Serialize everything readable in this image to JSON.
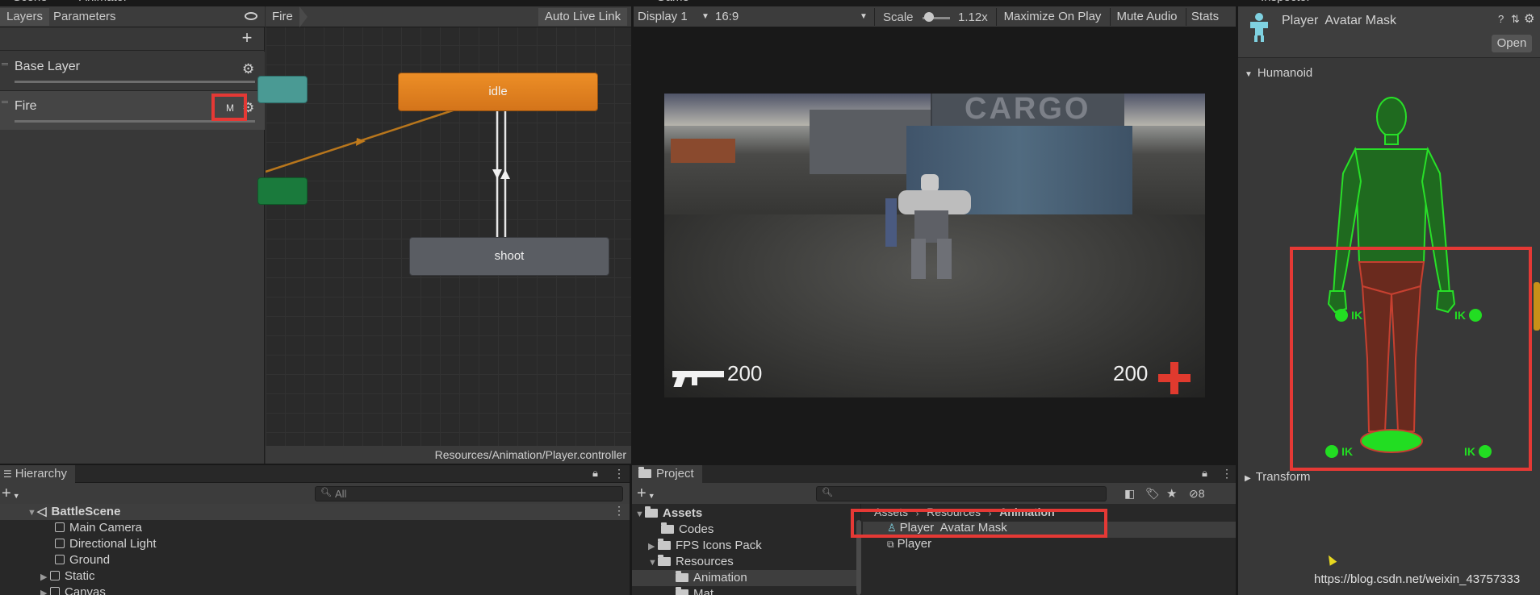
{
  "top_tabs": {
    "scene": "Scene",
    "animator": "Animator",
    "game": "Game",
    "inspector": "Inspector"
  },
  "animator": {
    "tabs": [
      "Layers",
      "Parameters"
    ],
    "breadcrumb": "Fire",
    "auto_live_link": "Auto Live Link",
    "layers": [
      {
        "name": "Base Layer"
      },
      {
        "name": "Fire",
        "badge": "M"
      }
    ],
    "states": {
      "idle": "idle",
      "shoot": "shoot"
    },
    "footer_path": "Resources/Animation/Player.controller"
  },
  "game": {
    "display": "Display 1",
    "aspect": "16:9",
    "scale_label": "Scale",
    "scale_value": "1.12x",
    "maximize": "Maximize On Play",
    "mute": "Mute Audio",
    "stats": "Stats",
    "ammo": "200",
    "health": "200",
    "scene_text": "CARGO"
  },
  "inspector": {
    "asset_title": "Player  Avatar Mask",
    "open_button": "Open",
    "humanoid": "Humanoid",
    "transform": "Transform",
    "ik_label": "IK"
  },
  "hierarchy": {
    "title": "Hierarchy",
    "search_placeholder": "All",
    "items": [
      {
        "label": "BattleScene"
      },
      {
        "label": "Main Camera"
      },
      {
        "label": "Directional Light"
      },
      {
        "label": "Ground"
      },
      {
        "label": "Static"
      },
      {
        "label": "Canvas"
      }
    ]
  },
  "project": {
    "title": "Project",
    "hidden_count": "8",
    "tree": [
      {
        "label": "Assets"
      },
      {
        "label": "Codes"
      },
      {
        "label": "FPS Icons Pack"
      },
      {
        "label": "Resources"
      },
      {
        "label": "Animation"
      },
      {
        "label": "Mat"
      }
    ],
    "breadcrumb": [
      "Assets",
      "Resources",
      "Animation"
    ],
    "files": [
      {
        "label": "Player  Avatar Mask"
      },
      {
        "label": "Player"
      }
    ]
  },
  "watermark": "https://blog.csdn.net/weixin_43757333",
  "colors": {
    "accent_red": "#e53935",
    "idle_state": "#e8851c",
    "mask_green": "#22dd22",
    "mask_red": "#b03020"
  }
}
